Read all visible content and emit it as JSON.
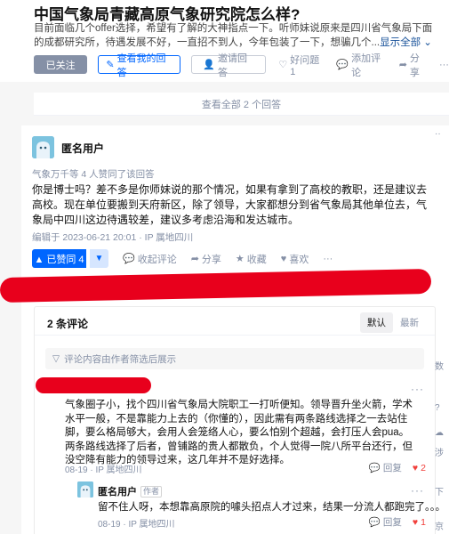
{
  "question": {
    "title": "中国气象局青藏高原气象研究院怎么样?",
    "description": "目前面临几个offer选择，希望有了解的大神指点一下。听师妹说原来是四川省气象局下面的成都研究所，待遇发展不好，一直招不到人，今年包装了一下，想骗几个...",
    "show_all": "显示全部",
    "followed_label": "已关注",
    "my_answer_label": "查看我的回答",
    "invite_label": "邀请回答",
    "good_q_label": "好问题 1",
    "comment_label": "添加评论",
    "share_label": "分享",
    "more_label": "···"
  },
  "view_all": "查看全部 2 个回答",
  "answer": {
    "author": "匿名用户",
    "voters": "气象万千等 4 人赞同了该回答",
    "content": "你是博士吗？差不多是你师妹说的那个情况，如果有拿到了高校的教职，还是建议去高校。现在单位要搬到天府新区，除了领导，大家都想分到省气象局其他单位去，气象局中四川这边待遇较差，建议多考虑沿海和发达城市。",
    "edit_time": "编辑于 2023-06-21 20:01 · IP 属地四川",
    "upvote_label": "▲ 已赞同 4",
    "downvote_label": "▼",
    "collapse_comment_label": "收起评论",
    "share_label": "分享",
    "favorite_label": "收藏",
    "like_label": "喜欢",
    "more_label": "···"
  },
  "comments": {
    "count_label": "2 条评论",
    "sort_default": "默认",
    "sort_latest": "最新",
    "filter_notice": "评论内容由作者筛选后展示",
    "items": [
      {
        "content": "气象圈子小，找个四川省气象局大院职工一打听便知。领导晋升坐火箭，学术水平一般，不是靠能力上去的（你懂的），因此需有两条路线选择之一去站住脚，要么格局够大，会用人会笼络人心，要么怕别个超越，会打压人会pua。两条路线选择了后者，曾铺路的贵人都散负，个人觉得一院八所平台还行，但没空降有能力的领导过来，这几年并不是好选择。",
        "meta": "08-19 · IP 属地四川",
        "reply_label": "回复",
        "like_count": "2",
        "more_label": "···"
      },
      {
        "author": "匿名用户",
        "author_tag": "作者",
        "content": "留不住人呀，本想靠高原院的噱头招点人才过来，结果一分流人都跑完了。。。",
        "meta": "08-19 · IP 属地四川",
        "reply_label": "回复",
        "like_count": "1",
        "more_label": "···"
      }
    ]
  },
  "sidebar_fragments": [
    "··",
    "数",
    "?",
    "☁",
    "涉",
    "下",
    "京"
  ]
}
